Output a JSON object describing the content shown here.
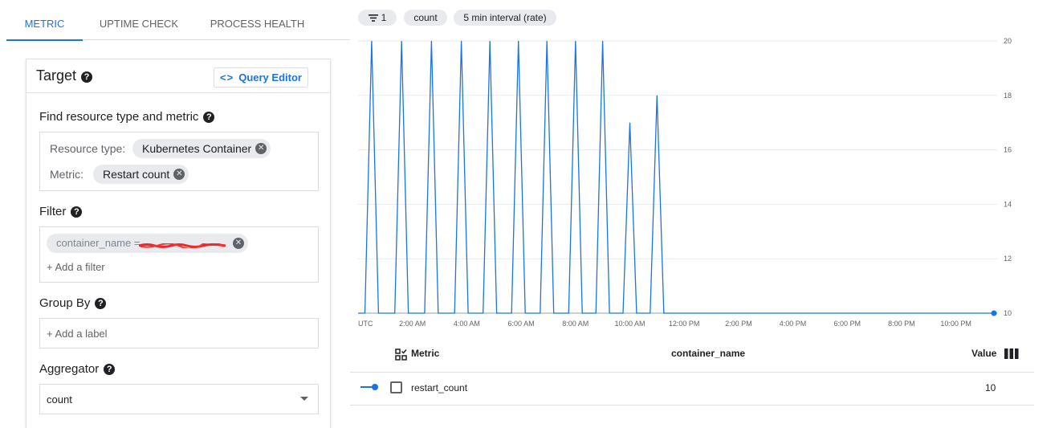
{
  "tabs": [
    {
      "label": "METRIC",
      "active": true
    },
    {
      "label": "UPTIME CHECK",
      "active": false
    },
    {
      "label": "PROCESS HEALTH",
      "active": false
    }
  ],
  "target": {
    "title": "Target",
    "query_editor_label": "Query Editor",
    "query_editor_icon": "code-icon"
  },
  "resource_section": {
    "label": "Find resource type and metric",
    "resource_type_label": "Resource type:",
    "resource_type_value": "Kubernetes Container",
    "metric_label": "Metric:",
    "metric_value": "Restart count"
  },
  "filter_section": {
    "label": "Filter",
    "chip_text": "container_name =",
    "add_filter": "+ Add a filter"
  },
  "group_by": {
    "label": "Group By",
    "add_label": "+ Add a label"
  },
  "aggregator": {
    "label": "Aggregator",
    "value": "count"
  },
  "toolbar": {
    "filter_count": "1",
    "count_label": "count",
    "interval_label": "5 min interval (rate)"
  },
  "chart_data": {
    "type": "line",
    "ylim": [
      10,
      20
    ],
    "yticks": [
      10,
      12,
      14,
      16,
      18,
      20
    ],
    "xlabels": [
      "UTC",
      "2:00 AM",
      "4:00 AM",
      "6:00 AM",
      "8:00 AM",
      "10:00 AM",
      "12:00 PM",
      "2:00 PM",
      "4:00 PM",
      "6:00 PM",
      "8:00 PM",
      "10:00 PM"
    ],
    "xrange_hours": [
      0,
      23.4
    ],
    "series": [
      {
        "color": "#1a73e8",
        "points": [
          [
            0.0,
            10
          ],
          [
            0.25,
            10
          ],
          [
            0.5,
            20
          ],
          [
            0.75,
            10
          ],
          [
            1.35,
            10
          ],
          [
            1.6,
            20
          ],
          [
            1.85,
            10
          ],
          [
            2.45,
            10
          ],
          [
            2.7,
            20
          ],
          [
            2.95,
            10
          ],
          [
            3.55,
            10
          ],
          [
            3.8,
            20
          ],
          [
            4.05,
            10
          ],
          [
            4.6,
            10
          ],
          [
            4.85,
            20
          ],
          [
            5.1,
            10
          ],
          [
            5.65,
            10
          ],
          [
            5.9,
            20
          ],
          [
            6.15,
            10
          ],
          [
            6.7,
            10
          ],
          [
            6.95,
            20
          ],
          [
            7.2,
            10
          ],
          [
            7.75,
            10
          ],
          [
            8.0,
            20
          ],
          [
            8.25,
            10
          ],
          [
            8.75,
            10
          ],
          [
            9.0,
            20
          ],
          [
            9.25,
            10
          ],
          [
            9.75,
            10
          ],
          [
            10.0,
            17
          ],
          [
            10.25,
            10
          ],
          [
            10.75,
            10
          ],
          [
            11.0,
            18
          ],
          [
            11.25,
            10
          ],
          [
            23.4,
            10
          ]
        ]
      }
    ]
  },
  "legend": {
    "metric_header": "Metric",
    "column_header": "container_name",
    "value_header": "Value",
    "rows": [
      {
        "metric": "restart_count",
        "value": "10"
      }
    ]
  }
}
